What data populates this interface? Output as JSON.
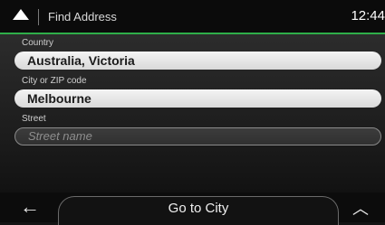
{
  "header": {
    "title": "Find Address",
    "time": "12:44"
  },
  "form": {
    "country_label": "Country",
    "country_value": "Australia, Victoria",
    "city_label": "City or ZIP code",
    "city_value": "Melbourne",
    "street_label": "Street",
    "street_placeholder": "Street name"
  },
  "footer": {
    "back_glyph": "←",
    "go_label": "Go to City",
    "more_glyph": "︿"
  },
  "colors": {
    "accent": "#2fae49",
    "field_bg": "#f0f0f0",
    "background": "#141414"
  }
}
